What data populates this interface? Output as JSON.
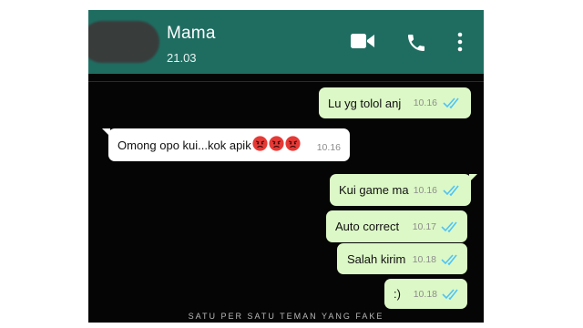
{
  "header": {
    "contact_name": "Mama",
    "last_seen": "21.03",
    "icons": [
      "video-call-icon",
      "voice-call-icon",
      "more-options-icon"
    ]
  },
  "messages": [
    {
      "direction": "outgoing",
      "text": "Lu yg tolol anj",
      "time": "10.16",
      "status": "read"
    },
    {
      "direction": "incoming",
      "text": "Omong opo kui...kok apik",
      "emoji_count": 3,
      "emoji": "angry-face",
      "time": "10.16"
    },
    {
      "direction": "outgoing",
      "text": "Kui game ma",
      "time": "10.16",
      "status": "read"
    },
    {
      "direction": "outgoing",
      "text": "Auto correct",
      "time": "10.17",
      "status": "read"
    },
    {
      "direction": "outgoing",
      "text": "Salah kirim",
      "time": "10.18",
      "status": "read"
    },
    {
      "direction": "outgoing",
      "text": ":)",
      "time": "10.18",
      "status": "read"
    }
  ],
  "watermark": "SATU PER SATU TEMAN YANG FAKE",
  "colors": {
    "header": "#1f6d61",
    "chat_background": "#050505",
    "outgoing_bubble": "#dcf8c6",
    "incoming_bubble": "#ffffff",
    "read_ticks": "#4fc3f7",
    "emoji_red": "#e53935"
  }
}
